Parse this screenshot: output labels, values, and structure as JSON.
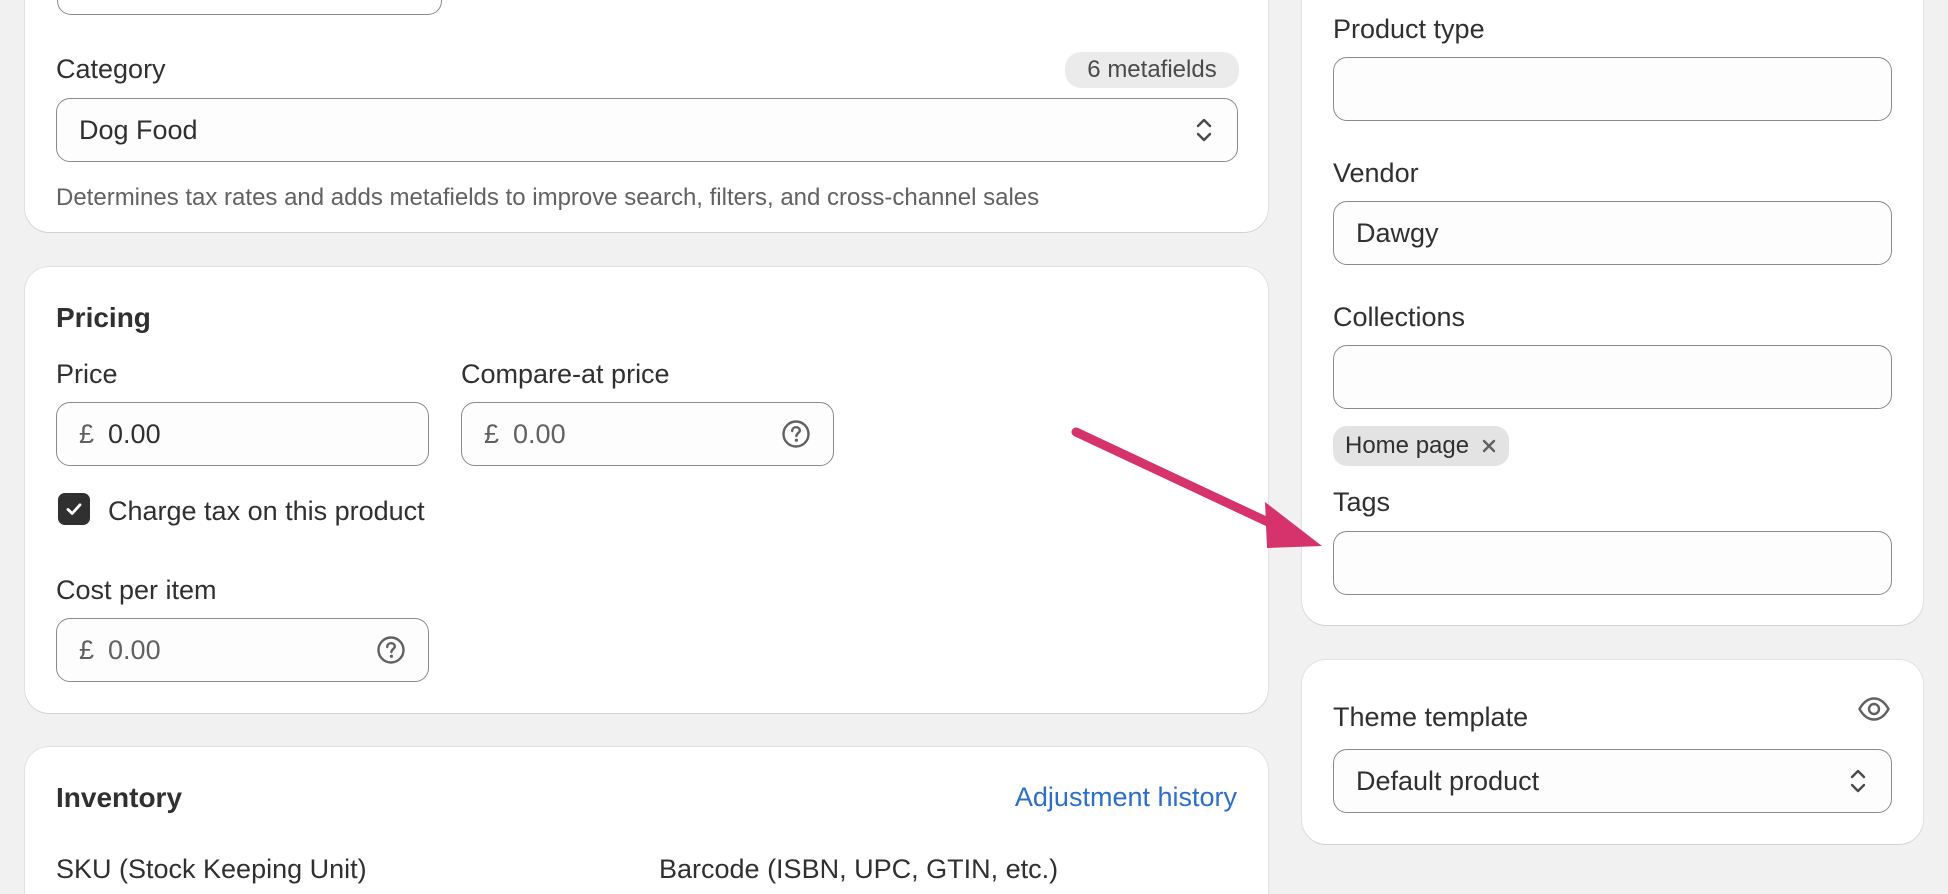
{
  "organization": {
    "category_label": "Category",
    "category_badge": "6 metafields",
    "category_value": "Dog Food",
    "category_hint": "Determines tax rates and adds metafields to improve search, filters, and cross-channel sales"
  },
  "pricing": {
    "title": "Pricing",
    "price_label": "Price",
    "price_currency": "£",
    "price_value": "0.00",
    "compare_label": "Compare-at price",
    "compare_currency": "£",
    "compare_placeholder": "0.00",
    "charge_tax_label": "Charge tax on this product",
    "charge_tax_checked": true,
    "cost_label": "Cost per item",
    "cost_currency": "£",
    "cost_placeholder": "0.00"
  },
  "inventory": {
    "title": "Inventory",
    "adjustment_link": "Adjustment history",
    "sku_label": "SKU (Stock Keeping Unit)",
    "barcode_label": "Barcode (ISBN, UPC, GTIN, etc.)"
  },
  "product_org": {
    "product_type_label": "Product type",
    "product_type_value": "",
    "vendor_label": "Vendor",
    "vendor_value": "Dawgy",
    "collections_label": "Collections",
    "collections_value": "",
    "collection_chips": [
      "Home page"
    ],
    "tags_label": "Tags",
    "tags_value": ""
  },
  "theme": {
    "label": "Theme template",
    "value": "Default product"
  },
  "annotation": {
    "arrow_color": "#d6336c"
  },
  "icons": {
    "select": "chevron-up-down-icon",
    "help": "question-circle-icon",
    "remove": "close-icon",
    "preview": "eye-icon",
    "check": "checkmark-icon"
  }
}
